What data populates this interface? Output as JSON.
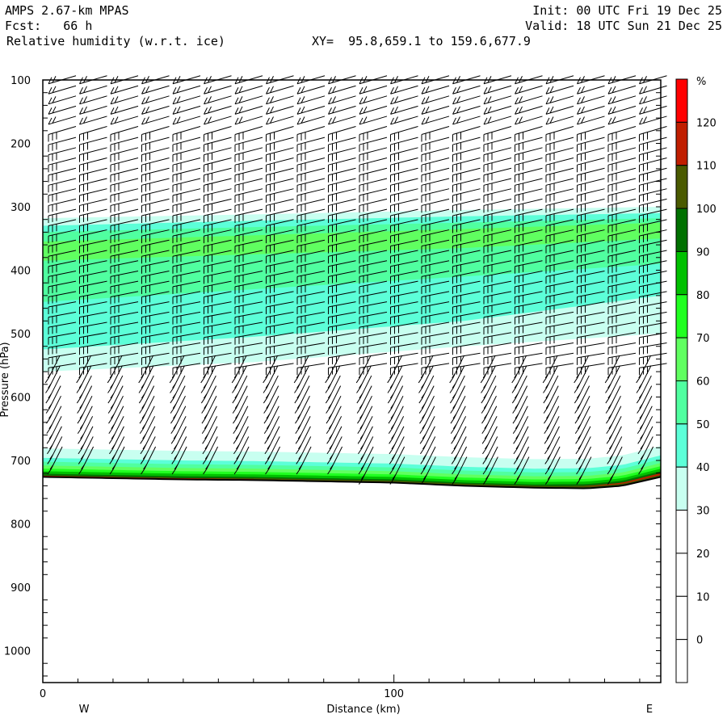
{
  "header": {
    "model": "AMPS 2.67-km MPAS",
    "forecast": "Fcst:   66 h",
    "field": "Relative humidity (w.r.t. ice)",
    "xy": "XY=  95.8,659.1 to 159.6,677.9",
    "init": "Init: 00 UTC Fri 19 Dec 25",
    "valid": "Valid: 18 UTC Sun 21 Dec 25"
  },
  "chart_data": {
    "type": "heatmap",
    "title": "Relative humidity (w.r.t. ice)",
    "xlabel": "Distance (km)",
    "ylabel": "Pressure (hPa)",
    "xlim": [
      0,
      176
    ],
    "ylim": [
      1050,
      100
    ],
    "x_ticks": [
      {
        "value": 0,
        "label": "0"
      },
      {
        "value": 100,
        "label": "100"
      }
    ],
    "x_direction_labels": {
      "west": "W",
      "east": "E"
    },
    "y_ticks": [
      {
        "value": 100,
        "label": "100"
      },
      {
        "value": 200,
        "label": "200"
      },
      {
        "value": 300,
        "label": "300"
      },
      {
        "value": 400,
        "label": "400"
      },
      {
        "value": 500,
        "label": "500"
      },
      {
        "value": 600,
        "label": "600"
      },
      {
        "value": 700,
        "label": "700"
      },
      {
        "value": 800,
        "label": "800"
      },
      {
        "value": 900,
        "label": "900"
      },
      {
        "value": 1000,
        "label": "1000"
      }
    ],
    "colorbar": {
      "unit": "%",
      "labels": [
        "120",
        "110",
        "100",
        "90",
        "80",
        "70",
        "60",
        "50",
        "40",
        "30",
        "20",
        "10",
        "0"
      ],
      "colors": [
        "#ff0000",
        "#c01e00",
        "#4a5a00",
        "#007000",
        "#00c000",
        "#20ff20",
        "#60ff60",
        "#50ffa0",
        "#5cffd8",
        "#c8fff0",
        "#ffffff",
        "#ffffff",
        "#ffffff",
        "#ffffff"
      ]
    },
    "terrain_surface_pressure": {
      "distance_km": [
        0,
        20,
        40,
        60,
        80,
        100,
        120,
        140,
        155,
        165,
        176
      ],
      "pressure_hpa": [
        726,
        728,
        730,
        731,
        733,
        735,
        740,
        743,
        744,
        740,
        726
      ]
    },
    "rh_upper_bands": [
      {
        "range": "30-40",
        "distance_km": [
          0,
          60,
          120,
          176
        ],
        "top_hpa": [
          318,
          312,
          305,
          300
        ],
        "bottom_hpa": [
          560,
          545,
          520,
          500
        ]
      },
      {
        "range": "40-50",
        "distance_km": [
          0,
          60,
          120,
          176
        ],
        "top_hpa": [
          330,
          322,
          315,
          310
        ],
        "bottom_hpa": [
          525,
          505,
          480,
          440
        ]
      },
      {
        "range": "50-60",
        "distance_km": [
          0,
          60,
          120,
          176
        ],
        "top_hpa": [
          340,
          332,
          325,
          318
        ],
        "bottom_hpa": [
          450,
          430,
          410,
          390
        ]
      },
      {
        "range": "60-70",
        "distance_km": [
          0,
          60,
          120,
          176
        ],
        "top_hpa": [
          355,
          345,
          335,
          325
        ],
        "bottom_hpa": [
          385,
          375,
          365,
          350
        ]
      }
    ],
    "rh_lower_bands_depth_above_surface_hpa": [
      {
        "range": "30-40",
        "depth": 45
      },
      {
        "range": "40-50",
        "depth": 30
      },
      {
        "range": "50-60",
        "depth": 24
      },
      {
        "range": "60-70",
        "depth": 18
      },
      {
        "range": "70-80",
        "depth": 13
      },
      {
        "range": "80-90",
        "depth": 9
      },
      {
        "range": "90-100",
        "depth": 5
      },
      {
        "range": "110-120",
        "depth": 2
      }
    ],
    "wind_barbs": {
      "columns": 20,
      "level_spacing_hpa": 16,
      "top_hpa": 100
    }
  }
}
